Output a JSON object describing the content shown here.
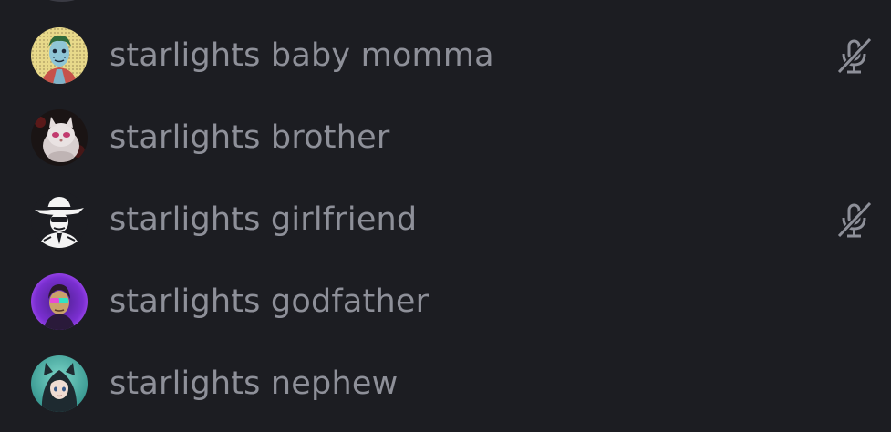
{
  "members": [
    {
      "name": "starlights baby momma",
      "avatar_icon": "avatar-zombie-icon",
      "muted": true
    },
    {
      "name": "starlights brother",
      "avatar_icon": "avatar-cat-icon",
      "muted": false
    },
    {
      "name": "starlights girlfriend",
      "avatar_icon": "avatar-cowboy-icon",
      "muted": true
    },
    {
      "name": "starlights godfather",
      "avatar_icon": "avatar-neon-icon",
      "muted": false
    },
    {
      "name": "starlights nephew",
      "avatar_icon": "avatar-anime-icon",
      "muted": false
    }
  ],
  "colors": {
    "background": "#1c1d22",
    "name_text": "#8e9099",
    "mute_icon": "#8e9099"
  }
}
